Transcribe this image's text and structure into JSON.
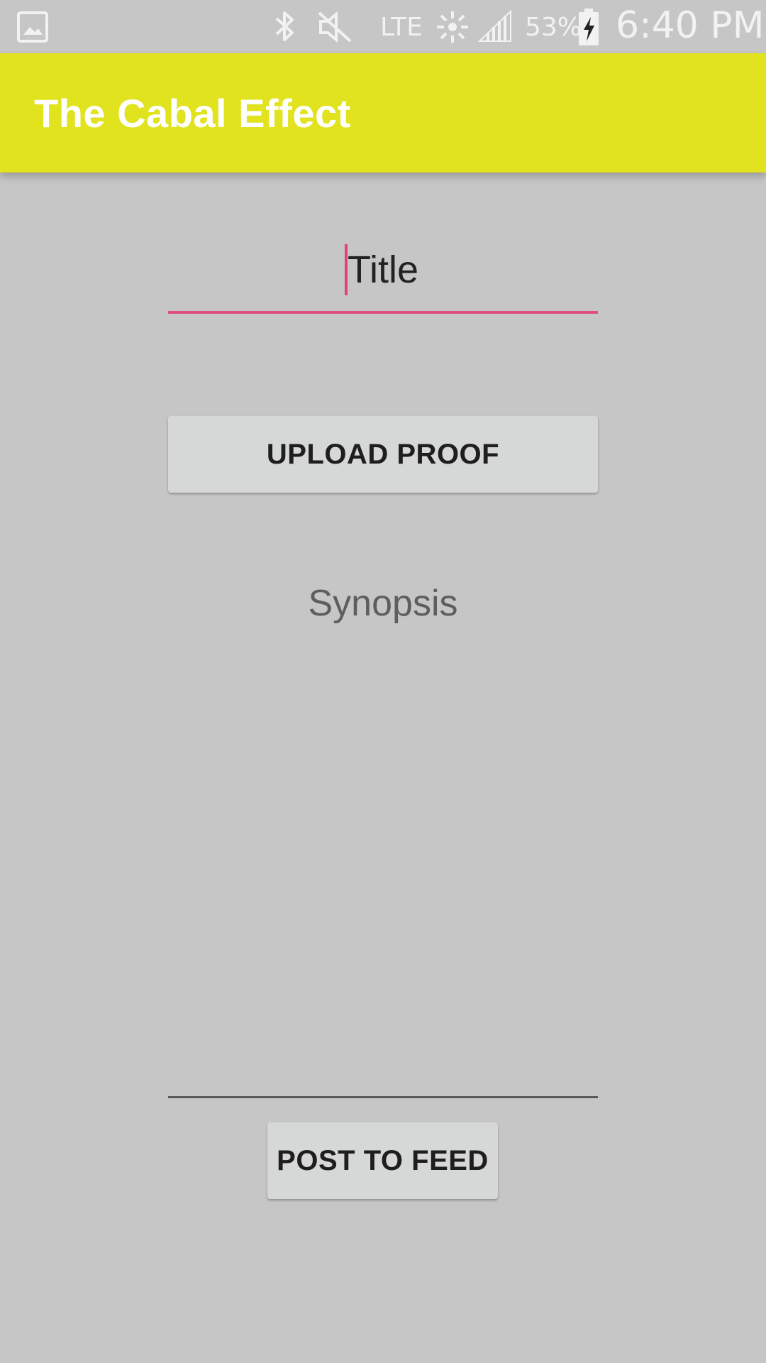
{
  "status_bar": {
    "network": "LTE",
    "battery": "53%",
    "time": "6:40 PM",
    "icons": [
      "gallery-icon",
      "bluetooth-icon",
      "mute-icon",
      "sync-icon",
      "signal-icon",
      "battery-charging-icon"
    ]
  },
  "app_bar": {
    "title": "The Cabal Effect",
    "color": "#e0e31d"
  },
  "form": {
    "title_value": "Title",
    "upload_label": "UPLOAD PROOF",
    "synopsis_placeholder": "Synopsis",
    "post_label": "POST TO FEED",
    "accent_color": "#e04d80"
  }
}
